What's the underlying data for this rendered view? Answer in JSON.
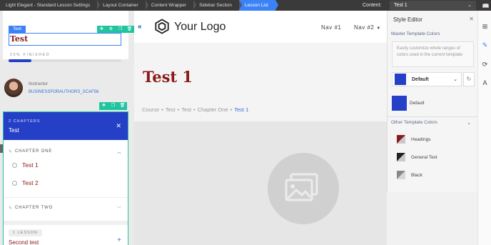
{
  "topbar": {
    "crumbs": [
      "Light Elegant - Standard Lesson Settings",
      "Layout Container",
      "Content Wrapper",
      "Sidebar Section",
      "Lesson List"
    ],
    "content_label": "Content:",
    "content_value": "Test 1"
  },
  "sidebar": {
    "text_tag": "Text",
    "text_value": "Test",
    "progress_label": "20% FINISHED",
    "progress_fraction": 0.2,
    "instructor_label": "Instructor",
    "instructor_name": "BUSINESSFORAUTHORS_SCAF56"
  },
  "lesson_panel": {
    "chapters_count": "2 CHAPTERS",
    "chapters_title": "Test",
    "chapters": [
      {
        "name": "CHAPTER ONE",
        "lessons": [
          "Test 1",
          "Test 2"
        ]
      },
      {
        "name": "CHAPTER TWO"
      }
    ],
    "lesson_count": "1 LESSON",
    "lesson_title": "Second test"
  },
  "main": {
    "logo_text": "Your Logo",
    "nav1": "Nav #1",
    "nav2": "Nav #2",
    "page_title": "Test 1",
    "breadcrumbs": [
      "Course",
      "Test",
      "Test",
      "Chapter One",
      "Test 1"
    ]
  },
  "style_editor": {
    "title": "Style Editor",
    "master_section": "Master Template Colors",
    "description": "Easily customize whole ranges of colors used in the current template",
    "selected_template": "Default",
    "default_label": "Default",
    "other_section": "Other Template Colors",
    "colors": [
      {
        "label": "Headings"
      },
      {
        "label": "General Text"
      },
      {
        "label": "Black"
      }
    ]
  },
  "colors": {
    "accent_blue": "#2540c7",
    "heading_red": "#8b1a1a",
    "edit_green": "#22c4a0",
    "selection_blue": "#3b82f6"
  }
}
